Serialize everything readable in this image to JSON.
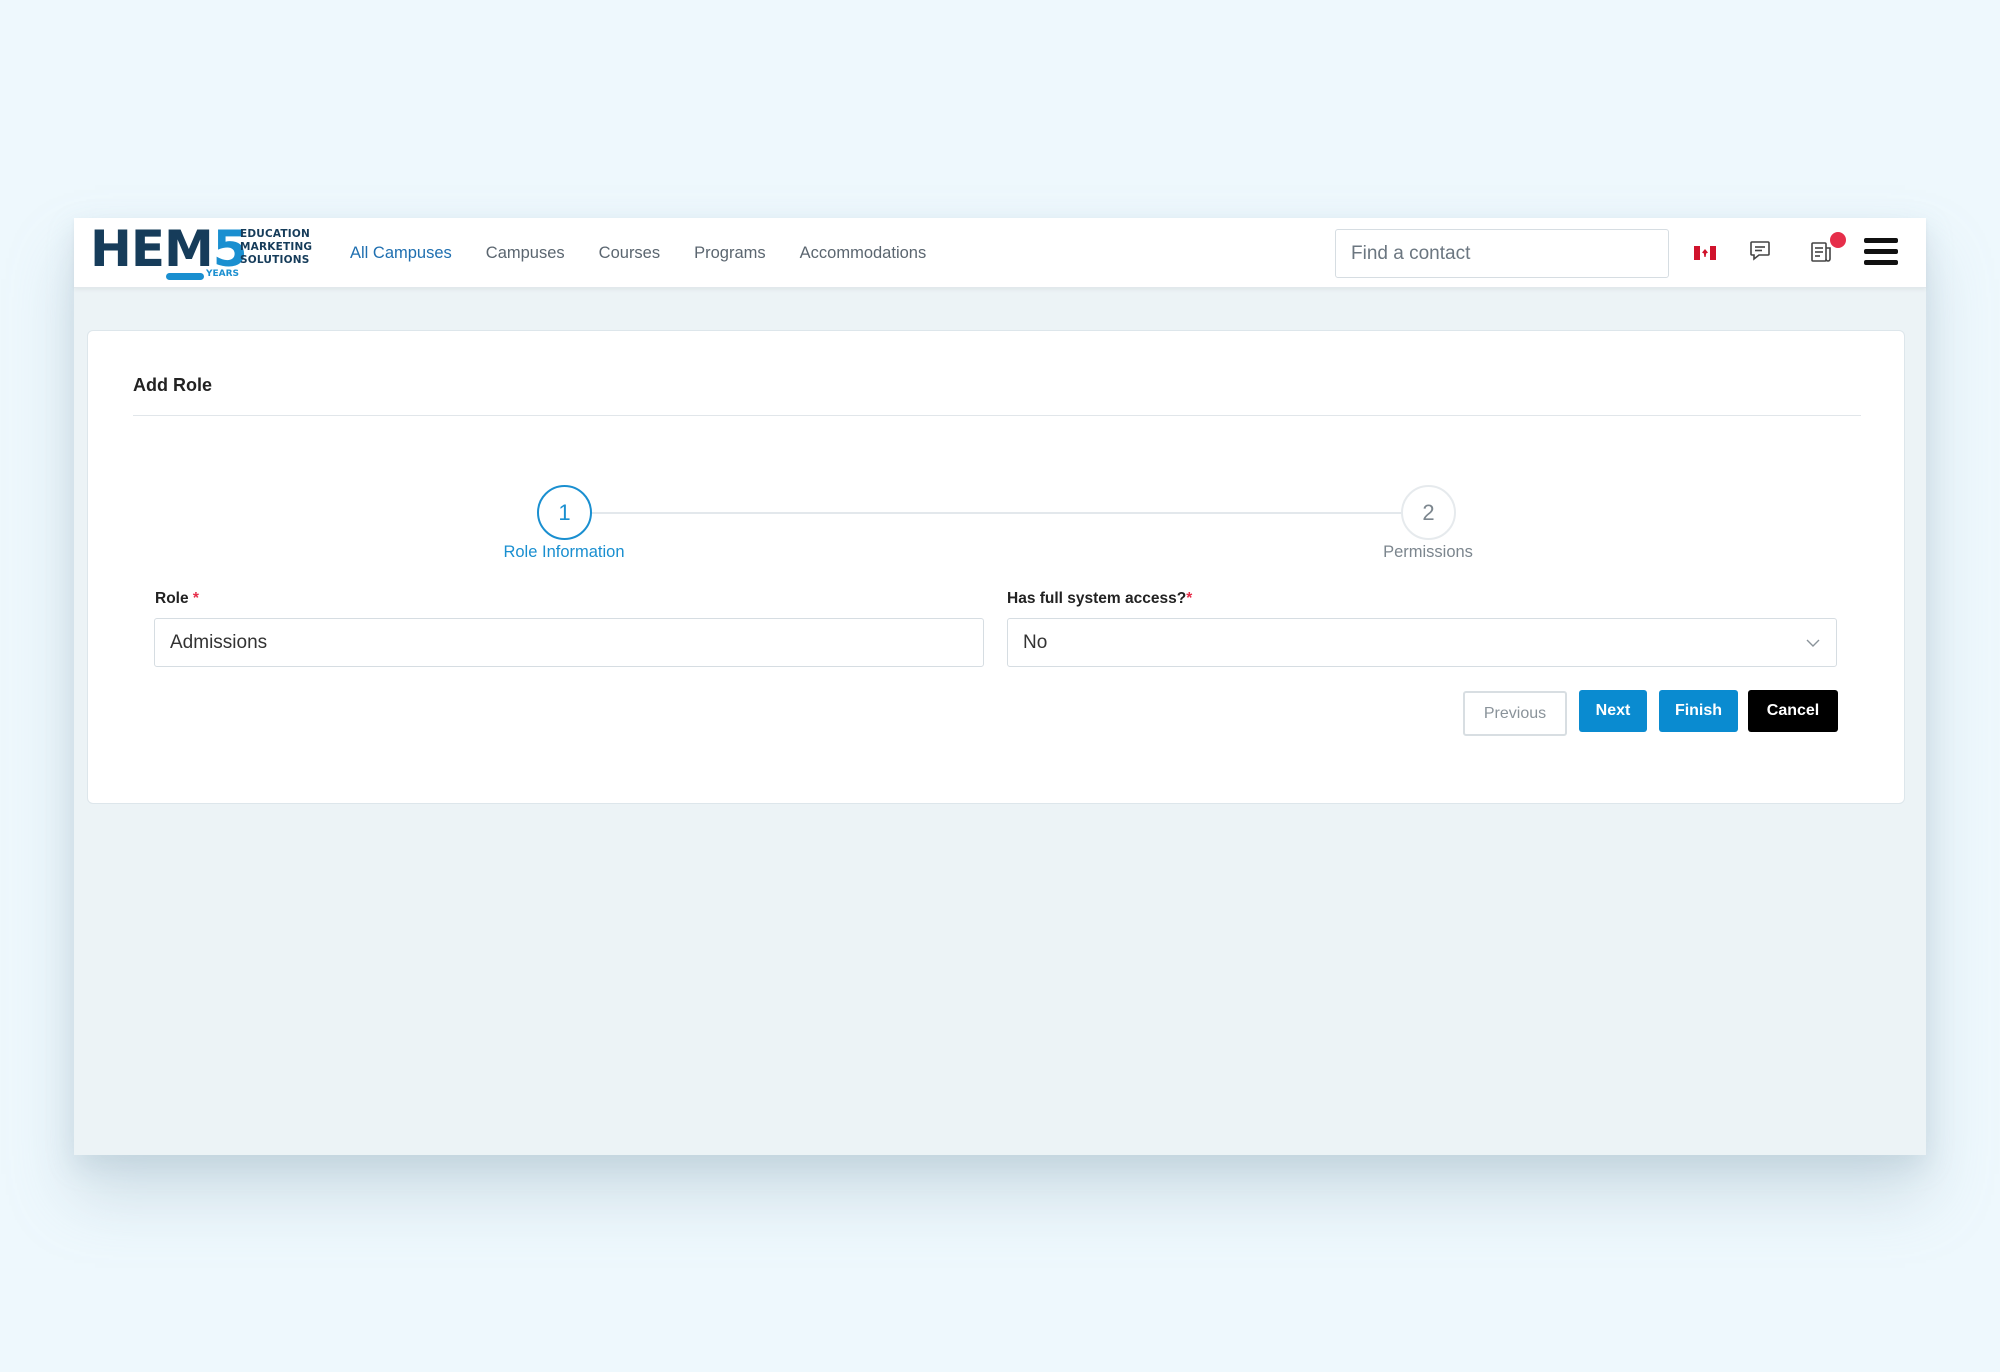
{
  "brand": {
    "logo_text": "HEM",
    "logo_digit": "5",
    "tagline": [
      "EDUCATION",
      "MARKETING",
      "SOLUTIONS"
    ],
    "years": "YEARS"
  },
  "nav": {
    "items": [
      {
        "label": "All Campuses",
        "active": true
      },
      {
        "label": "Campuses",
        "active": false
      },
      {
        "label": "Courses",
        "active": false
      },
      {
        "label": "Programs",
        "active": false
      },
      {
        "label": "Accommodations",
        "active": false
      }
    ],
    "search_placeholder": "Find a contact",
    "icons": [
      "canada-flag-icon",
      "chat-icon",
      "news-icon",
      "notification-dot",
      "hamburger-menu-icon"
    ]
  },
  "page": {
    "title": "Add Role",
    "steps": [
      {
        "number": "1",
        "label": "Role Information",
        "active": true
      },
      {
        "number": "2",
        "label": "Permissions",
        "active": false
      }
    ],
    "form": {
      "role_label": "Role",
      "role_required": "*",
      "role_value": "Admissions",
      "access_label": "Has full system access?",
      "access_required": "*",
      "access_value": "No"
    },
    "buttons": {
      "previous": "Previous",
      "next": "Next",
      "finish": "Finish",
      "cancel": "Cancel"
    }
  },
  "colors": {
    "primary": "#0a8bd0",
    "brand_dark": "#163c5a",
    "required": "#e62e4a",
    "background": "#eef8fd"
  }
}
